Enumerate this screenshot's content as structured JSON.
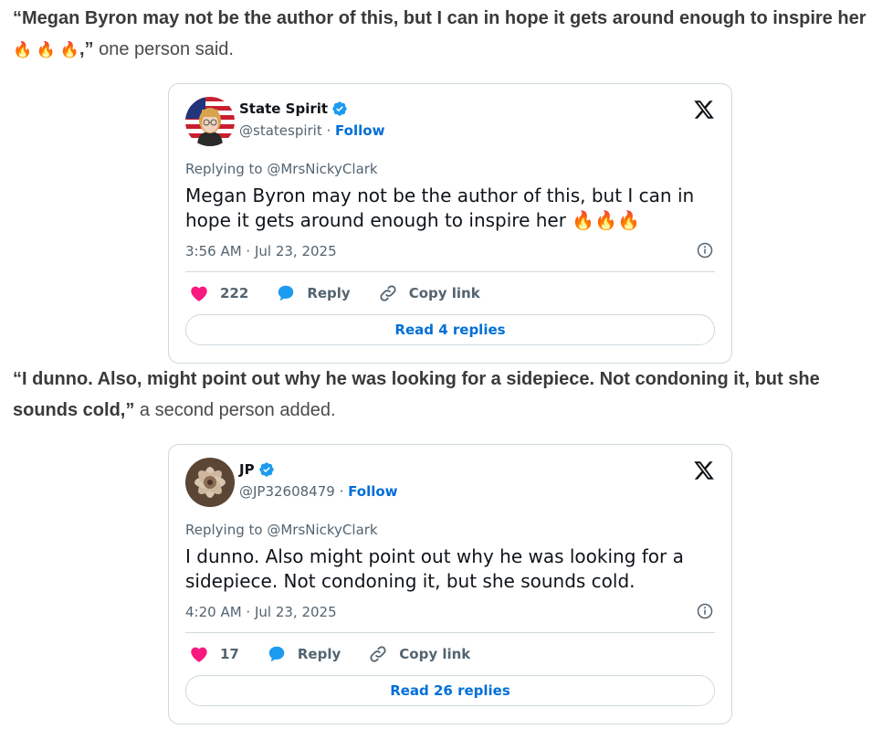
{
  "paragraph1": {
    "quote_bold": "“Megan Byron may not be the author of this, but I can in hope it gets around enough to inspire her",
    "emojis": "🔥 🔥 🔥",
    "quote_end": ",”",
    "tail": " one person said."
  },
  "tweet1": {
    "name": "State Spirit",
    "handle": "@statespirit",
    "follow": "Follow",
    "replying": "Replying to @MrsNickyClark",
    "text": "Megan Byron may not be the author of this, but I can in hope it gets around enough to inspire her  🔥🔥🔥",
    "time": "3:56 AM · Jul 23, 2025",
    "likes": "222",
    "reply": "Reply",
    "copy": "Copy link",
    "read": "Read 4 replies"
  },
  "paragraph2": {
    "quote_bold": "“I dunno. Also, might point out why he was looking for a sidepiece. Not condoning it, but she sounds cold,”",
    "tail": " a second person added."
  },
  "tweet2": {
    "name": "JP",
    "handle": "@JP32608479",
    "follow": "Follow",
    "replying": "Replying to @MrsNickyClark",
    "text": "I dunno.  Also might point out why he was looking for a sidepiece.  Not condoning it, but she sounds cold.",
    "time": "4:20 AM · Jul 23, 2025",
    "likes": "17",
    "reply": "Reply",
    "copy": "Copy link",
    "read": "Read 26 replies"
  },
  "colors": {
    "accent": "#006fd6",
    "heart": "#f91880",
    "reply_bubble": "#1d9bf0",
    "border": "#cfd9de"
  }
}
